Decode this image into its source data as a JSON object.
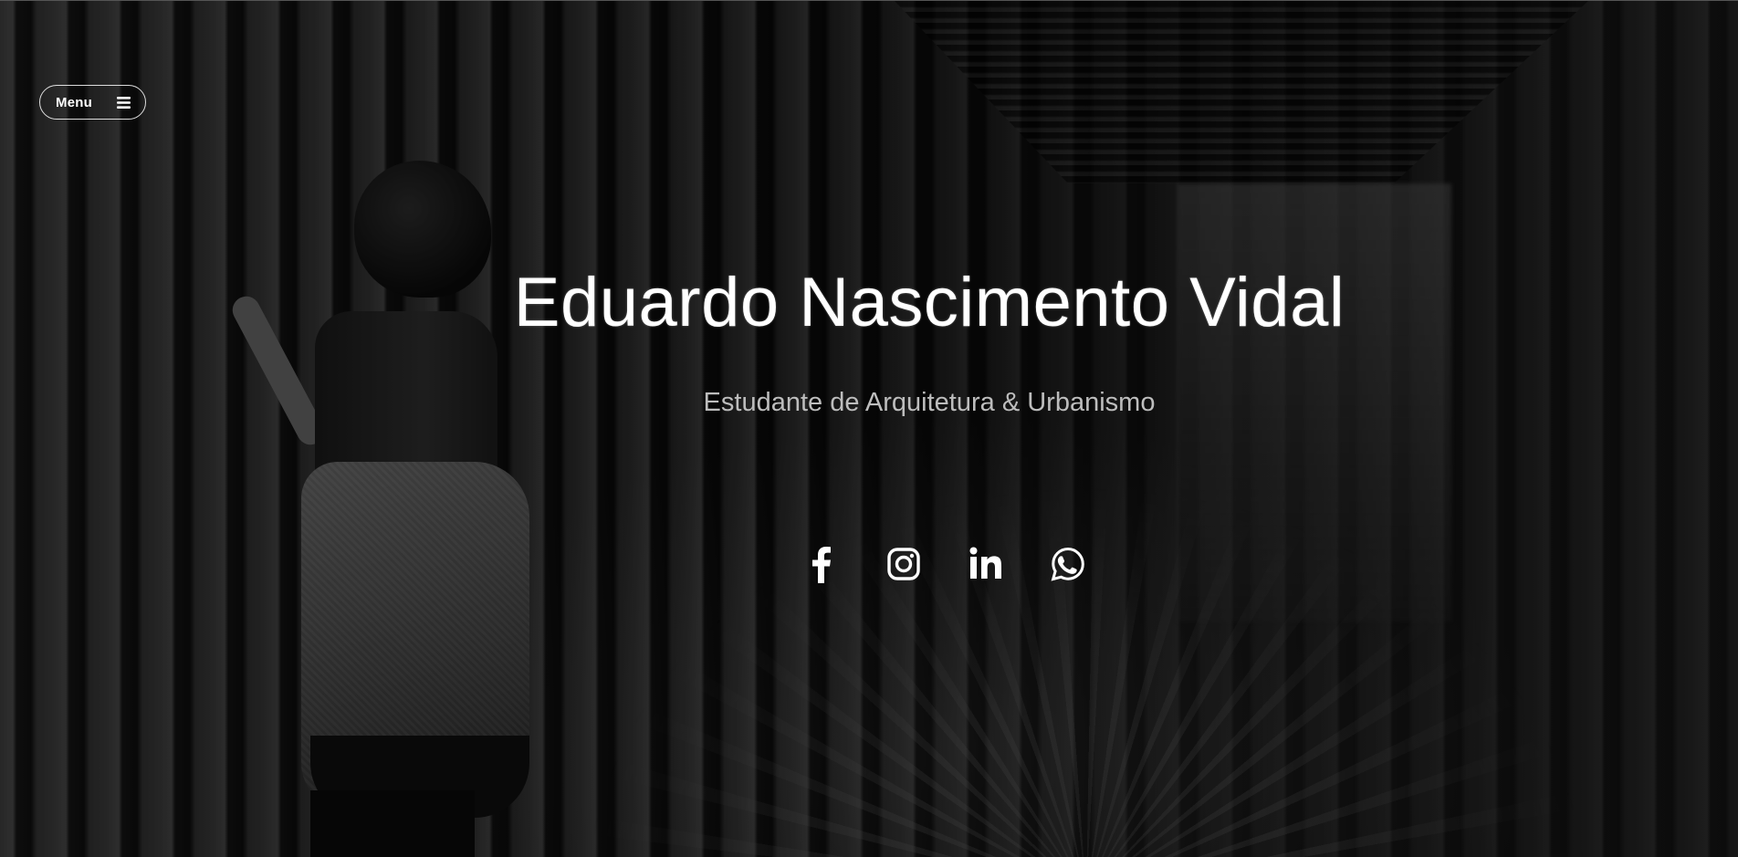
{
  "nav": {
    "menu_label": "Menu",
    "menu_icon": "hamburger-icon"
  },
  "hero": {
    "name": "Eduardo Nascimento Vidal",
    "tagline": "Estudante de Arquitetura & Urbanismo"
  },
  "social": [
    {
      "icon": "facebook-icon"
    },
    {
      "icon": "instagram-icon"
    },
    {
      "icon": "linkedin-icon"
    },
    {
      "icon": "whatsapp-icon"
    }
  ],
  "colors": {
    "text_primary": "#ffffff",
    "text_secondary": "#bdbdbd",
    "background": "#0d0d0d"
  }
}
